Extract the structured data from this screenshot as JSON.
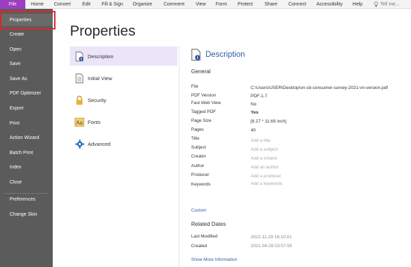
{
  "menubar": {
    "file": "File",
    "items": [
      "Home",
      "Convert",
      "Edit",
      "Fill & Sign",
      "Organize",
      "Comment",
      "View",
      "Form",
      "Protect",
      "Share",
      "Connect",
      "Accessibility",
      "Help"
    ],
    "tell_me": "Tell me..."
  },
  "sidebar": {
    "items": [
      "Properties",
      "Create",
      "Open",
      "Save",
      "Save As",
      "PDF Optimizer",
      "Export",
      "Print",
      "Action Wizard",
      "Batch Print",
      "Index",
      "Close"
    ],
    "bottom_items": [
      "Preferences",
      "Change Skin"
    ]
  },
  "page": {
    "title": "Properties"
  },
  "categories": [
    "Description",
    "Initial View",
    "Security",
    "Fonts",
    "Advanced"
  ],
  "description": {
    "heading": "Description",
    "general_label": "General",
    "properties": [
      {
        "label": "File",
        "value": "C:\\Users\\USER\\Desktop\\vn-cb-consumer-survey-2021-vn-version.pdf"
      },
      {
        "label": "PDF Version",
        "value": "PDF-1.7"
      },
      {
        "label": "Fast Web View",
        "value": "No"
      },
      {
        "label": "Tagged PDF",
        "value": "Yes"
      },
      {
        "label": "Page Size",
        "value": "[8.27 * 11.69 inch]"
      },
      {
        "label": "Pages",
        "value": "40"
      },
      {
        "label": "Title",
        "value": "Add a title"
      },
      {
        "label": "Subject",
        "value": "Add a subject"
      },
      {
        "label": "Creator",
        "value": "Add a creator"
      },
      {
        "label": "Author",
        "value": "Add an author"
      },
      {
        "label": "Producer",
        "value": "Add a producer"
      },
      {
        "label": "Keywords",
        "value": "Add a keywords"
      }
    ],
    "custom_link": "Custom",
    "related_dates_label": "Related Dates",
    "dates": [
      {
        "label": "Last Modified",
        "value": "2022-11-29 16:10:01"
      },
      {
        "label": "Created",
        "value": "2021-04-28 03:57:55"
      }
    ],
    "show_more": "Show More Information"
  },
  "colors": {
    "accent": "#9b3ec1",
    "sidebar": "#5b5b5b",
    "link": "#2d5aa8",
    "highlight": "#d9262c",
    "active_category": "#ece4f8"
  }
}
